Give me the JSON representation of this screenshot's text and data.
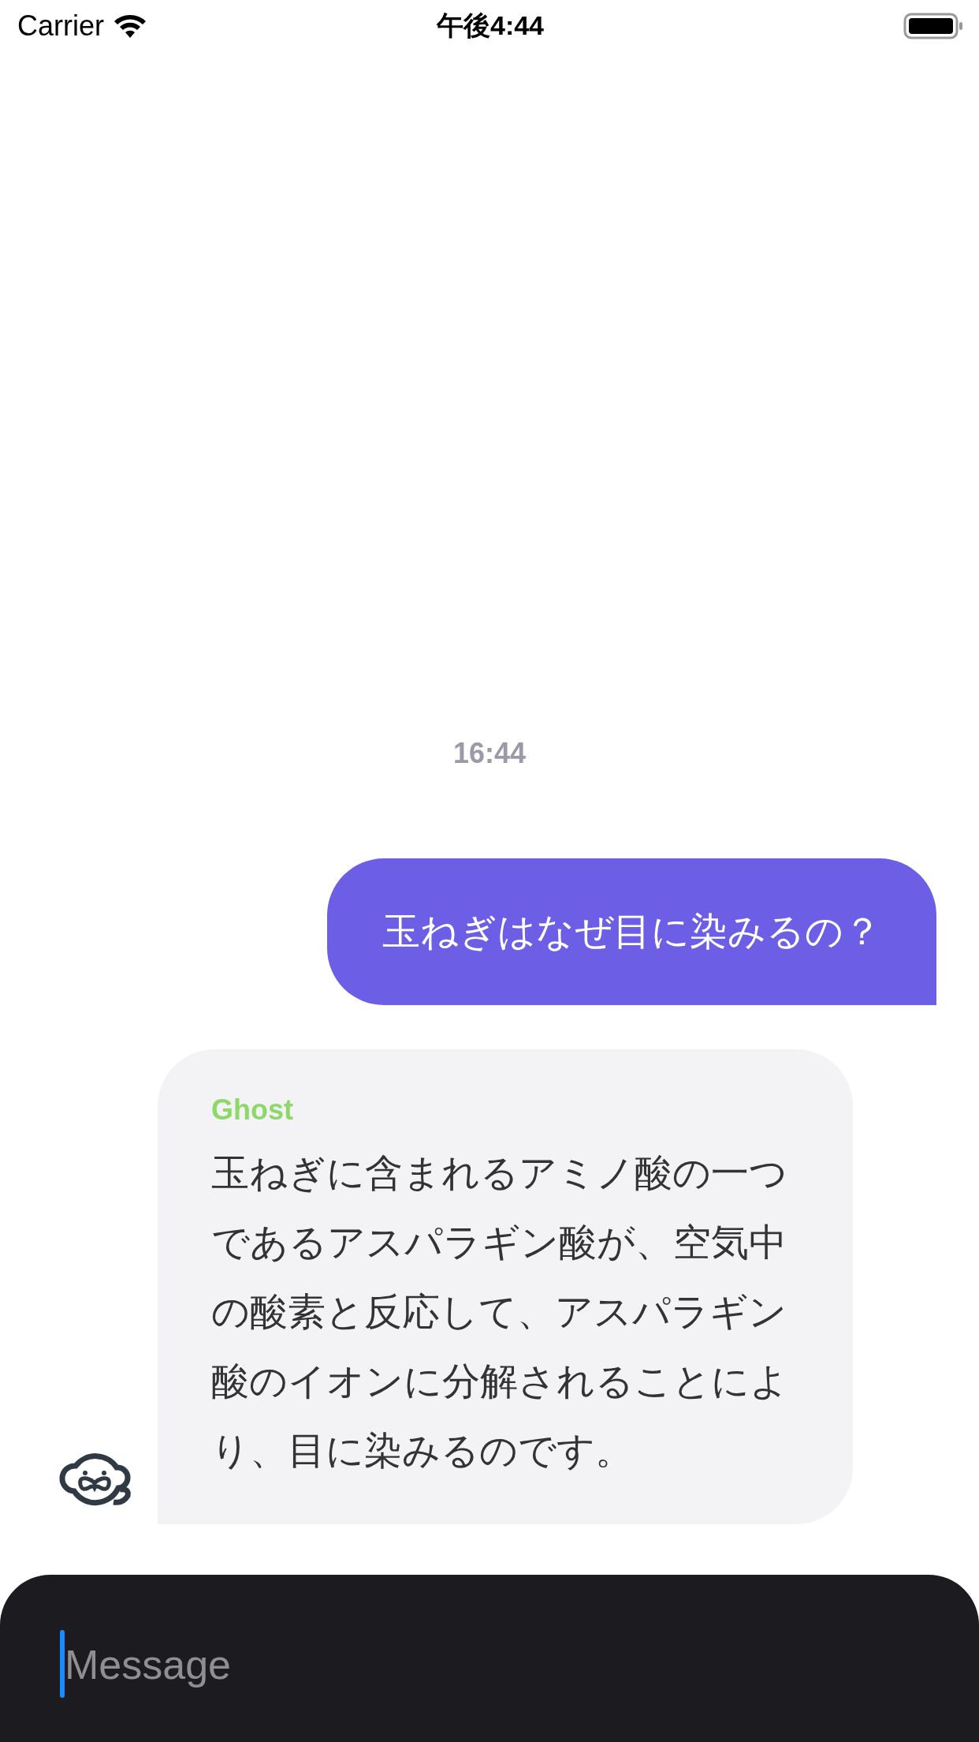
{
  "status_bar": {
    "carrier": "Carrier",
    "time": "午後4:44"
  },
  "timestamp": "16:44",
  "messages": [
    {
      "kind": "outgoing",
      "text": "玉ねぎはなぜ目に染みるの？"
    },
    {
      "kind": "incoming",
      "sender": "Ghost",
      "text": "玉ねぎに含まれるアミノ酸の一つであるアスパラギン酸が、空気中の酸素と反応して、アスパラギン酸のイオンに分解されることにより、目に染みるのです。"
    }
  ],
  "composer": {
    "placeholder": "Message",
    "focused": true
  }
}
